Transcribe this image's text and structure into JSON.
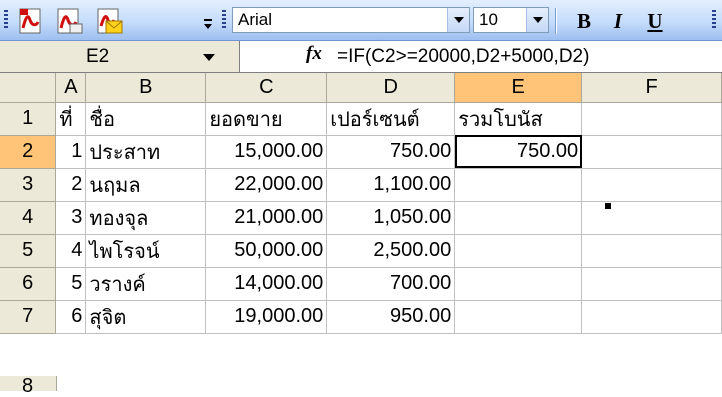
{
  "toolbar": {
    "icons": [
      "pdf-convert-icon",
      "pdf-review-icon",
      "pdf-email-icon",
      "toolbar-options-icon"
    ],
    "font_name": "Arial",
    "font_size": "10",
    "bold_label": "B",
    "italic_label": "I",
    "underline_label": "U"
  },
  "formula_bar": {
    "name_box": "E2",
    "fx_label": "fx",
    "formula": "=IF(C2>=20000,D2+5000,D2)"
  },
  "sheet": {
    "columns": [
      "A",
      "B",
      "C",
      "D",
      "E",
      "F"
    ],
    "row_numbers": [
      "1",
      "2",
      "3",
      "4",
      "5",
      "6",
      "7",
      "8"
    ],
    "active_cell": "E2",
    "rows": [
      [
        "ที่",
        "ชื่อ",
        "ยอดขาย",
        "เปอร์เซนต์",
        "รวมโบนัส",
        ""
      ],
      [
        "1",
        "ประสาท",
        "15,000.00",
        "750.00",
        "750.00",
        ""
      ],
      [
        "2",
        "นฤมล",
        "22,000.00",
        "1,100.00",
        "",
        ""
      ],
      [
        "3",
        "ทองจุล",
        "21,000.00",
        "1,050.00",
        "",
        ""
      ],
      [
        "4",
        "ไพโรจน์",
        "50,000.00",
        "2,500.00",
        "",
        ""
      ],
      [
        "5",
        "วรางค์",
        "14,000.00",
        "700.00",
        "",
        ""
      ],
      [
        "6",
        "สุจิต",
        "19,000.00",
        "950.00",
        "",
        ""
      ]
    ]
  }
}
